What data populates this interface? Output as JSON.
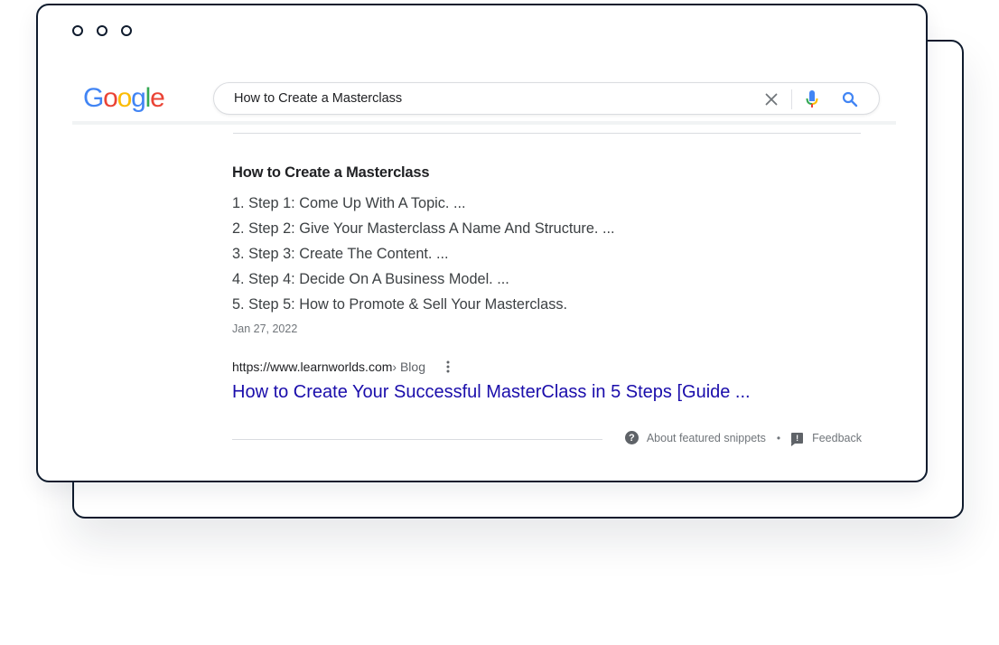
{
  "window": {
    "traffic_lights": [
      "window-dot",
      "window-dot",
      "window-dot"
    ]
  },
  "logo": {
    "letters": [
      "G",
      "o",
      "o",
      "g",
      "l",
      "e"
    ],
    "colors": [
      "#4285F4",
      "#EA4335",
      "#FBBC05",
      "#4285F4",
      "#34A853",
      "#EA4335"
    ]
  },
  "search": {
    "query": "How to Create a Masterclass",
    "clear_icon": "close-icon",
    "voice_icon": "microphone-icon",
    "search_icon": "search-icon"
  },
  "snippet": {
    "title": "How to Create a Masterclass",
    "steps": [
      "1. Step 1: Come Up With A Topic. ...",
      "2. Step 2: Give Your Masterclass A Name And Structure. ...",
      "3. Step 3: Create The Content. ...",
      "4. Step 4: Decide On A Business Model. ...",
      "5. Step 5: How to Promote & Sell Your Masterclass."
    ],
    "date": "Jan 27, 2022",
    "source_url": "https://www.learnworlds.com",
    "source_crumb": " › Blog",
    "result_link": "How to Create Your Successful MasterClass in 5 Steps [Guide ..."
  },
  "footer": {
    "about_label": "About featured snippets",
    "separator": "•",
    "feedback_label": "Feedback"
  },
  "colors": {
    "link": "#1a0dab",
    "border": "#0f1b2d"
  }
}
